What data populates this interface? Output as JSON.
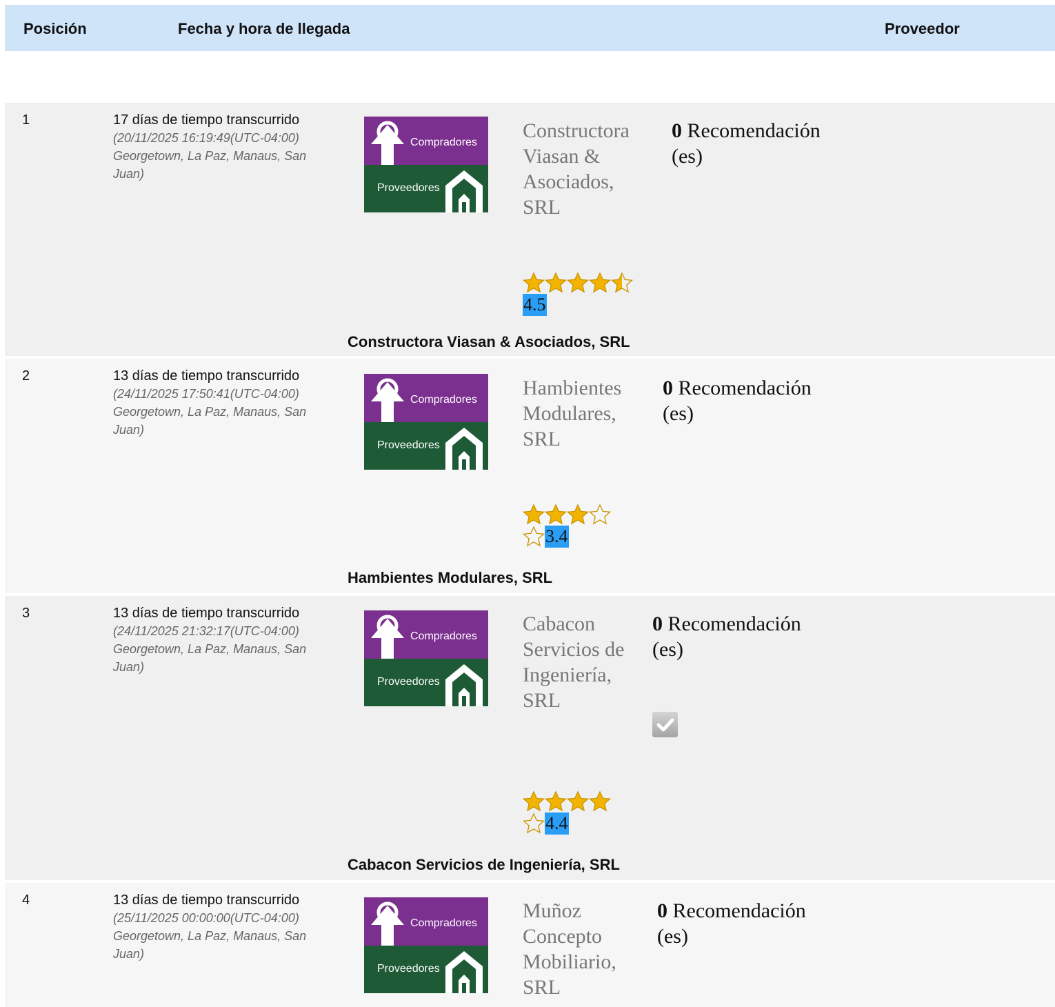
{
  "header": {
    "position": "Posición",
    "arrival": "Fecha y hora de llegada",
    "supplier": "Proveedor"
  },
  "logo": {
    "top_label": "Compradores",
    "bottom_label": "Proveedores",
    "purple": "#7b2f8e",
    "green": "#1e5a35"
  },
  "rows": [
    {
      "position": "1",
      "elapsed": "17 días de tiempo transcurrido",
      "timestamp": "(20/11/2025 16:19:49(UTC-04:00) Georgetown, La Paz, Manaus, San Juan)",
      "supplier": "Constructora Viasan & Asociados, SRL",
      "rec_count": "0",
      "rec_label": "Recomendación (es)",
      "stars": 4.5,
      "rating": "4.5",
      "bottom": "Constructora Viasan & Asociados, SRL"
    },
    {
      "position": "2",
      "elapsed": "13 días de tiempo transcurrido",
      "timestamp": "(24/11/2025 17:50:41(UTC-04:00) Georgetown, La Paz, Manaus, San Juan)",
      "supplier": "Hambientes Modulares, SRL",
      "rec_count": "0",
      "rec_label": "Recomendación (es)",
      "stars": 3,
      "rating": "3.4",
      "bottom": "Hambientes Modulares, SRL"
    },
    {
      "position": "3",
      "elapsed": "13 días de tiempo transcurrido",
      "timestamp": "(24/11/2025 21:32:17(UTC-04:00) Georgetown, La Paz, Manaus, San Juan)",
      "supplier": "Cabacon Servicios de Ingeniería, SRL",
      "rec_count": "0",
      "rec_label": "Recomendación (es)",
      "stars": 4,
      "rating": "4.4",
      "bottom": "Cabacon Servicios de Ingeniería, SRL"
    },
    {
      "position": "4",
      "elapsed": "13 días de tiempo transcurrido",
      "timestamp": "(25/11/2025 00:00:00(UTC-04:00) Georgetown, La Paz, Manaus, San Juan)",
      "supplier": "Muñoz Concepto Mobiliario, SRL",
      "rec_count": "0",
      "rec_label": "Recomendación (es)"
    }
  ],
  "icons": {
    "star": "star-icon",
    "check": "check-icon"
  },
  "colors": {
    "header_bg": "#cfe3f9",
    "rating_bg": "#2a9df4",
    "star_gold": "#f2b400"
  }
}
